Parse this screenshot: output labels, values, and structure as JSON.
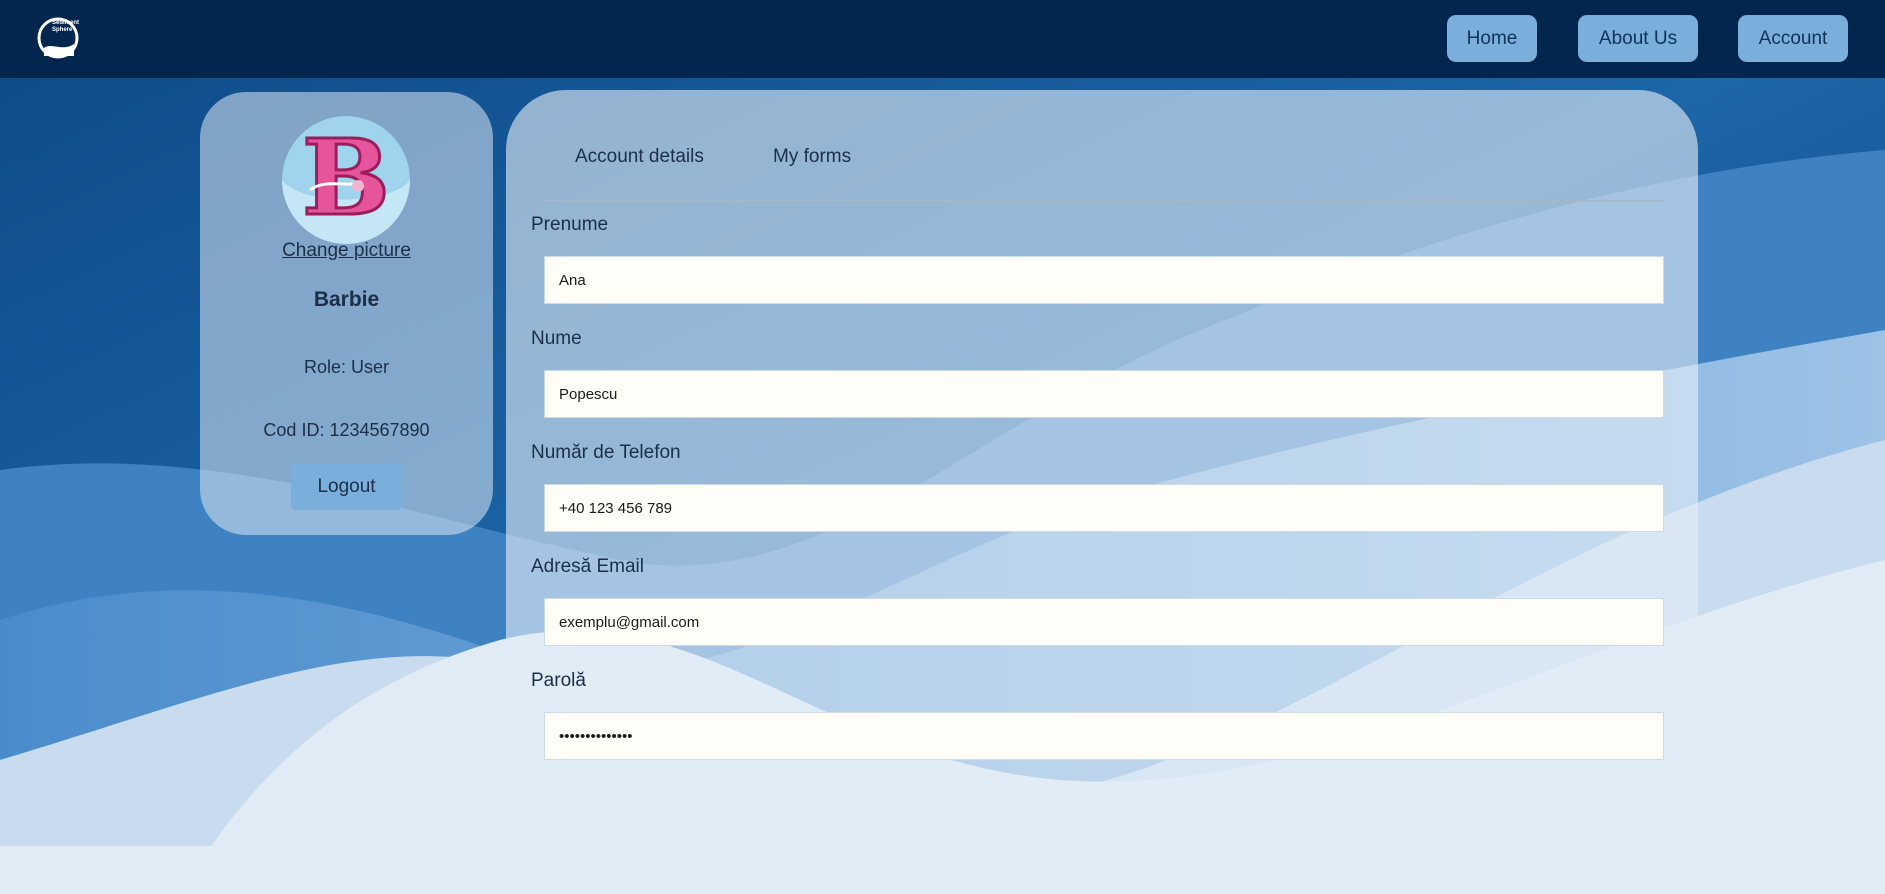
{
  "nav": {
    "logo_text": "Sediment Sphere",
    "home_label": "Home",
    "about_label": "About Us",
    "account_label": "Account"
  },
  "profile": {
    "change_picture_label": "Change picture",
    "username": "Barbie",
    "role": "Role: User",
    "cod_id": "Cod ID: 1234567890",
    "logout_label": "Logout",
    "avatar_icon": "barbie-logo-avatar"
  },
  "tabs": {
    "account_details": "Account details",
    "my_forms": "My forms"
  },
  "form": {
    "prenume_label": "Prenume",
    "prenume_value": "Ana",
    "nume_label": "Nume",
    "nume_value": "Popescu",
    "telefon_label": "Număr de Telefon",
    "telefon_value": "+40 123 456 789",
    "email_label": "Adresă Email",
    "email_value": "exemplu@gmail.com",
    "parola_label": "Parolă",
    "parola_value": "••••••••••••••"
  },
  "colors": {
    "topbar": "#03264f",
    "button": "#7aaedb",
    "text": "#1c2f48"
  }
}
